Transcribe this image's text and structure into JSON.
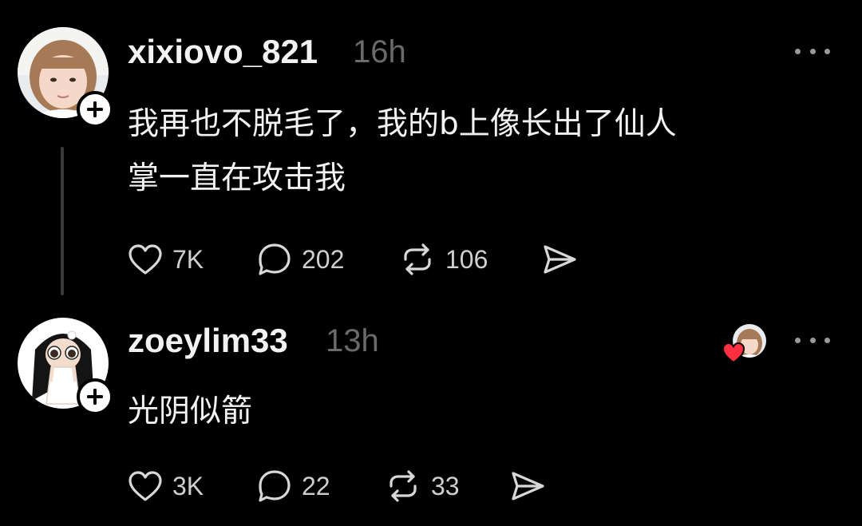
{
  "posts": [
    {
      "username": "xixiovo_821",
      "time": "16h",
      "text_line1": "我再也不脱毛了，我的b上像长出了仙人",
      "text_line2": "掌一直在攻击我",
      "likes": "7K",
      "replies": "202",
      "reposts": "106",
      "avatar_icon": "user-avatar-photo",
      "follow_icon": "plus-icon"
    },
    {
      "username": "zoeylim33",
      "time": "13h",
      "text_line1": "光阴似箭",
      "likes": "3K",
      "replies": "22",
      "reposts": "33",
      "avatar_icon": "cartoon-girl-avatar",
      "follow_icon": "plus-icon",
      "liked_by_icon": "liked-by-author-avatar"
    }
  ],
  "colors": {
    "background": "#000000",
    "text": "#f2f2f2",
    "muted": "#6a6a6a",
    "heart": "#ff3040"
  }
}
